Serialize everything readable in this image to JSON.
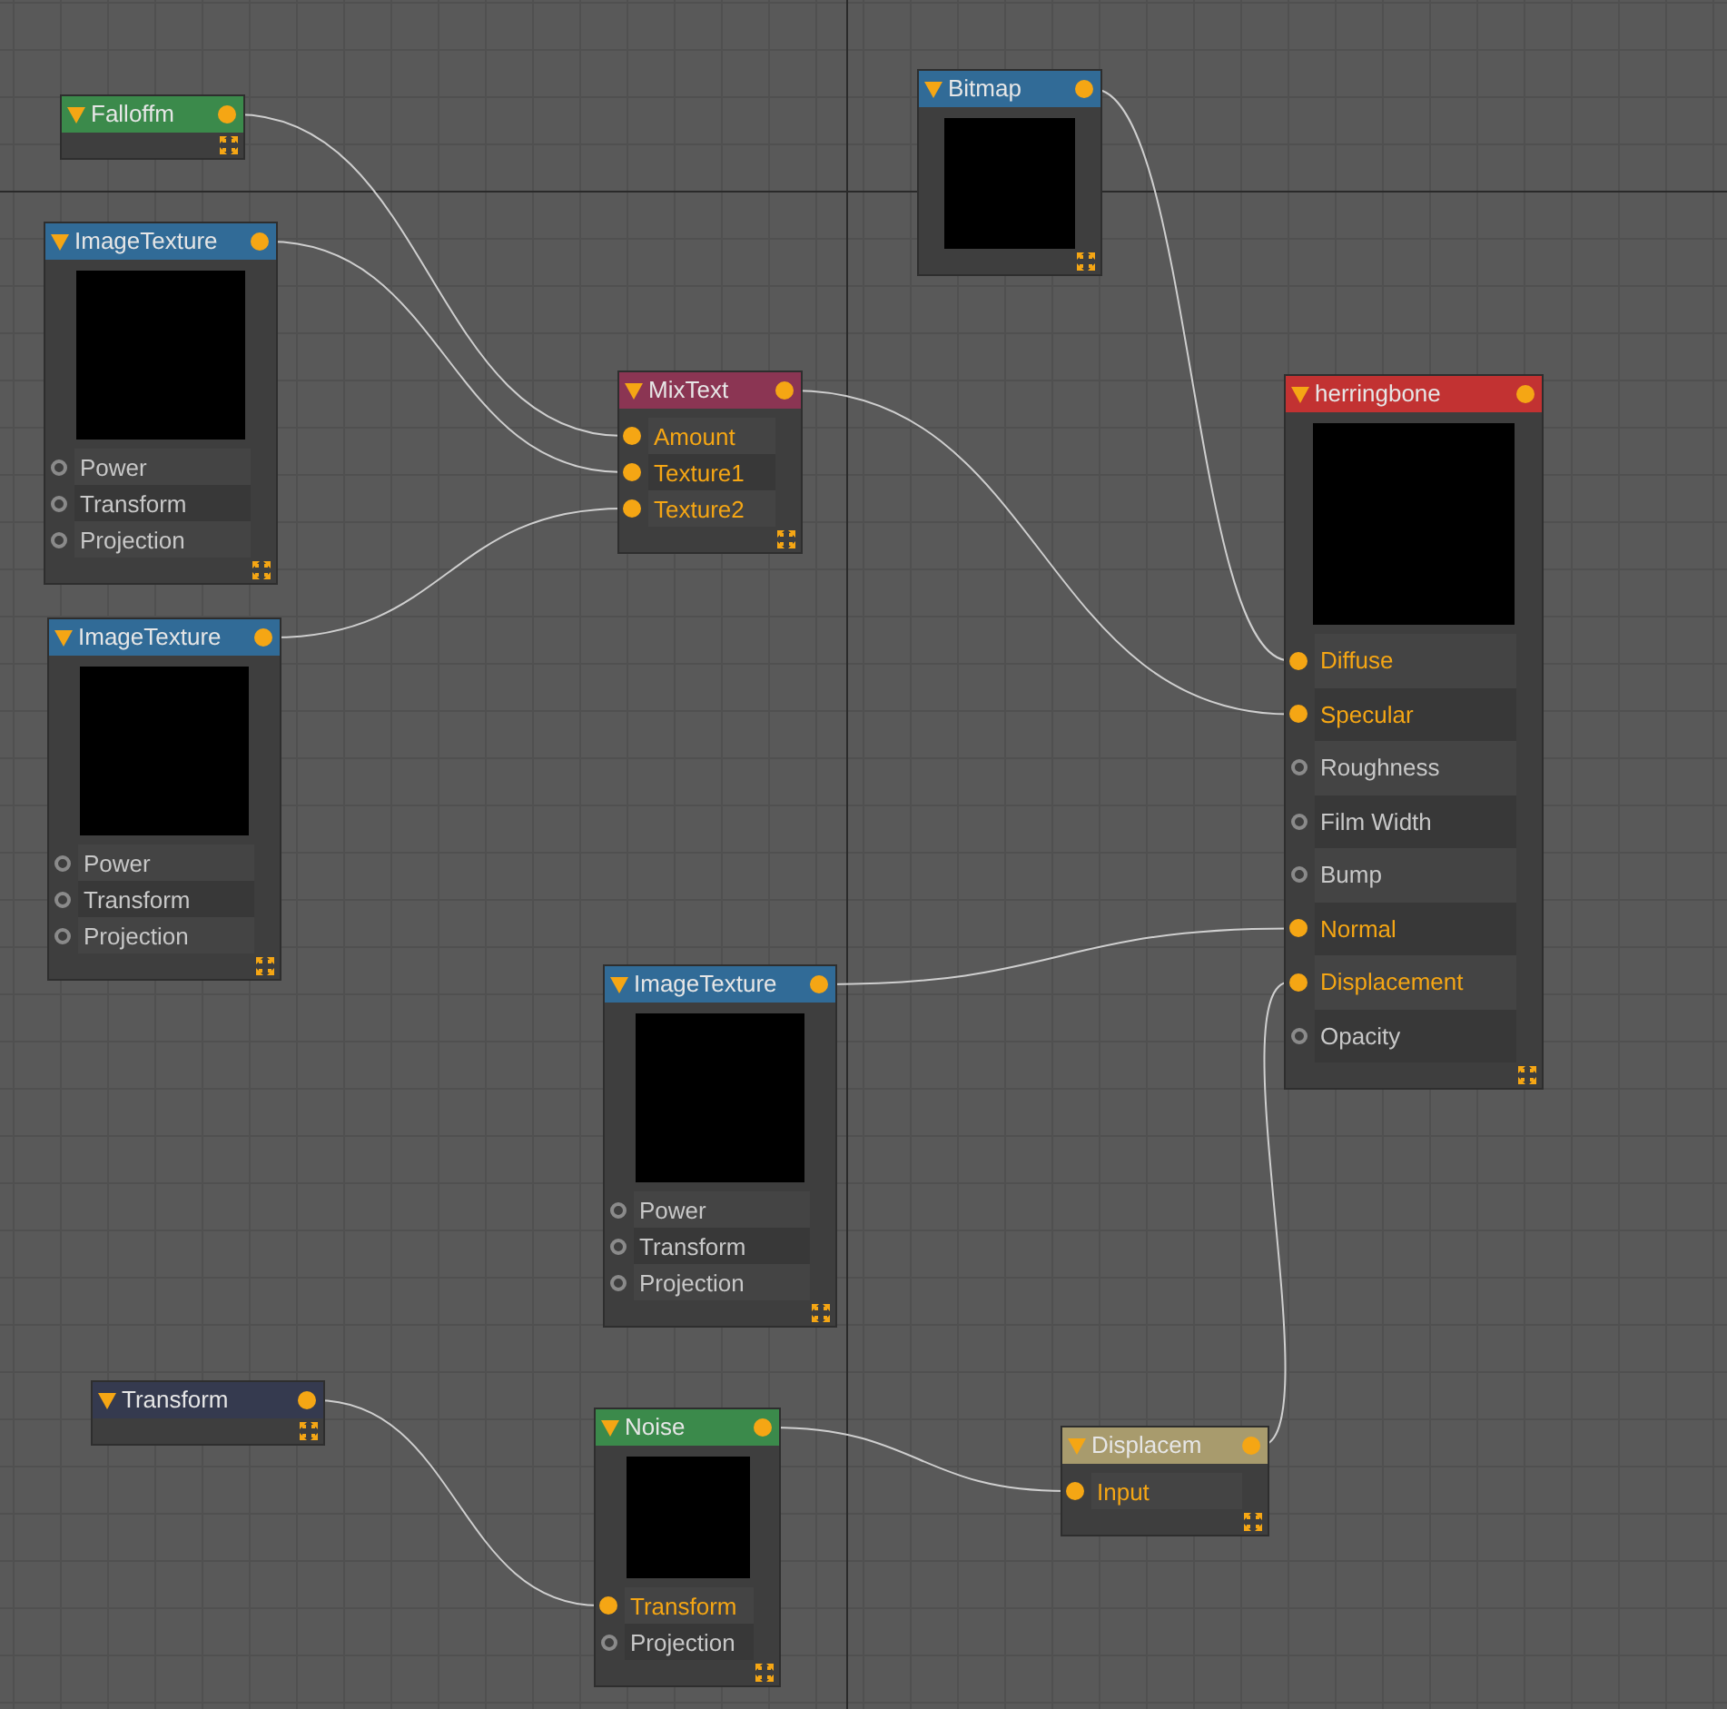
{
  "nodes": [
    {
      "title": "Falloffm",
      "color": "#3b8a4b",
      "preview": false
    },
    {
      "title": "ImageTexture",
      "color": "#316b97",
      "preview": true,
      "pins": [
        {
          "label": "Power",
          "connected": false
        },
        {
          "label": "Transform",
          "connected": false
        },
        {
          "label": "Projection",
          "connected": false
        }
      ]
    },
    {
      "title": "ImageTexture",
      "color": "#316b97",
      "preview": true,
      "pins": [
        {
          "label": "Power",
          "connected": false
        },
        {
          "label": "Transform",
          "connected": false
        },
        {
          "label": "Projection",
          "connected": false
        }
      ]
    },
    {
      "title": "Bitmap",
      "color": "#316b97",
      "preview": true
    },
    {
      "title": "MixText",
      "color": "#8b3553",
      "preview": false,
      "pins": [
        {
          "label": "Amount",
          "connected": true
        },
        {
          "label": "Texture1",
          "connected": true
        },
        {
          "label": "Texture2",
          "connected": true
        }
      ]
    },
    {
      "title": "herringbone",
      "color": "#c23232",
      "preview": true,
      "pins": [
        {
          "label": "Diffuse",
          "connected": true
        },
        {
          "label": "Specular",
          "connected": true
        },
        {
          "label": "Roughness",
          "connected": false
        },
        {
          "label": "Film Width",
          "connected": false
        },
        {
          "label": "Bump",
          "connected": false
        },
        {
          "label": "Normal",
          "connected": true
        },
        {
          "label": "Displacement",
          "connected": true
        },
        {
          "label": "Opacity",
          "connected": false
        }
      ]
    },
    {
      "title": "ImageTexture",
      "color": "#316b97",
      "preview": true,
      "pins": [
        {
          "label": "Power",
          "connected": false
        },
        {
          "label": "Transform",
          "connected": false
        },
        {
          "label": "Projection",
          "connected": false
        }
      ]
    },
    {
      "title": "Transform",
      "color": "#353a4f",
      "preview": false
    },
    {
      "title": "Noise",
      "color": "#3b8a4b",
      "preview": true,
      "pins": [
        {
          "label": "Transform",
          "connected": true
        },
        {
          "label": "Projection",
          "connected": false
        }
      ]
    },
    {
      "title": "Displacem",
      "color": "#a89b6d",
      "preview": false,
      "pins": [
        {
          "label": "Input",
          "connected": true
        }
      ]
    }
  ]
}
